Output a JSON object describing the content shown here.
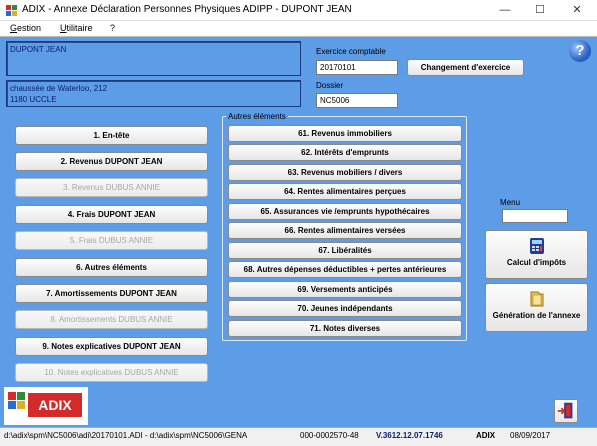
{
  "window": {
    "title": "ADIX - Annexe Déclaration Personnes Physiques ADIPP - DUPONT JEAN",
    "minimize_glyph": "—",
    "maximize_glyph": "☐",
    "close_glyph": "✕"
  },
  "menubar": {
    "items": [
      {
        "underline": "G",
        "rest": "estion"
      },
      {
        "underline": "U",
        "rest": "tilitaire"
      },
      {
        "underline": "",
        "rest": "?"
      }
    ]
  },
  "header": {
    "name": "DUPONT JEAN",
    "address_line1": "chaussée de Waterloo, 212",
    "address_line2": "1180  UCCLE",
    "exercice_label": "Exercice comptable",
    "exercice_value": "20170101",
    "change_button": "Changement d'exercice",
    "dossier_label": "Dossier",
    "dossier_value": "NC5006",
    "help_glyph": "?"
  },
  "left_buttons": [
    {
      "label": "1. En-tête",
      "enabled": true
    },
    {
      "label": "2. Revenus DUPONT JEAN",
      "enabled": true
    },
    {
      "label": "3. Revenus DUBUS ANNIE",
      "enabled": false
    },
    {
      "label": "4. Frais DUPONT JEAN",
      "enabled": true
    },
    {
      "label": "5. Frais DUBUS ANNIE",
      "enabled": false
    },
    {
      "label": "6. Autres éléments",
      "enabled": true
    },
    {
      "label": "7. Amortissements DUPONT JEAN",
      "enabled": true
    },
    {
      "label": "8. Amortissements DUBUS ANNIE",
      "enabled": false
    },
    {
      "label": "9. Notes explicatives DUPONT JEAN",
      "enabled": true
    },
    {
      "label": "10. Notes explicatives DUBUS ANNIE",
      "enabled": false
    }
  ],
  "autres": {
    "title": "Autres éléments",
    "buttons": [
      "61. Revenus immobiliers",
      "62. Intérêts d'emprunts",
      "63. Revenus mobiliers / divers",
      "64. Rentes alimentaires perçues",
      "65. Assurances vie /emprunts hypothécaires",
      "66. Rentes alimentaires versées",
      "67. Libéralités",
      "68. Autres dépenses déductibles + pertes antérieures",
      "69. Versements anticipés",
      "70. Jeunes indépendants",
      "71. Notes diverses"
    ]
  },
  "right": {
    "menu_label": "Menu",
    "menu_value": "",
    "calc_button": "Calcul d'impôts",
    "gen_button": "Génération de l'annexe"
  },
  "logo": {
    "text": "ADIX"
  },
  "status": {
    "path": "d:\\adix\\spm\\NC5006\\adi\\20170101.ADI - d:\\adix\\spm\\NC5006\\GENA",
    "code": "000-0002570-48",
    "version": "V.3612.12.07.1746",
    "app": "ADIX",
    "date": "08/09/2017"
  },
  "colors": {
    "background": "#5d9ce6",
    "logo_red": "#d42a2a",
    "help_blue": "#2e66c8"
  }
}
